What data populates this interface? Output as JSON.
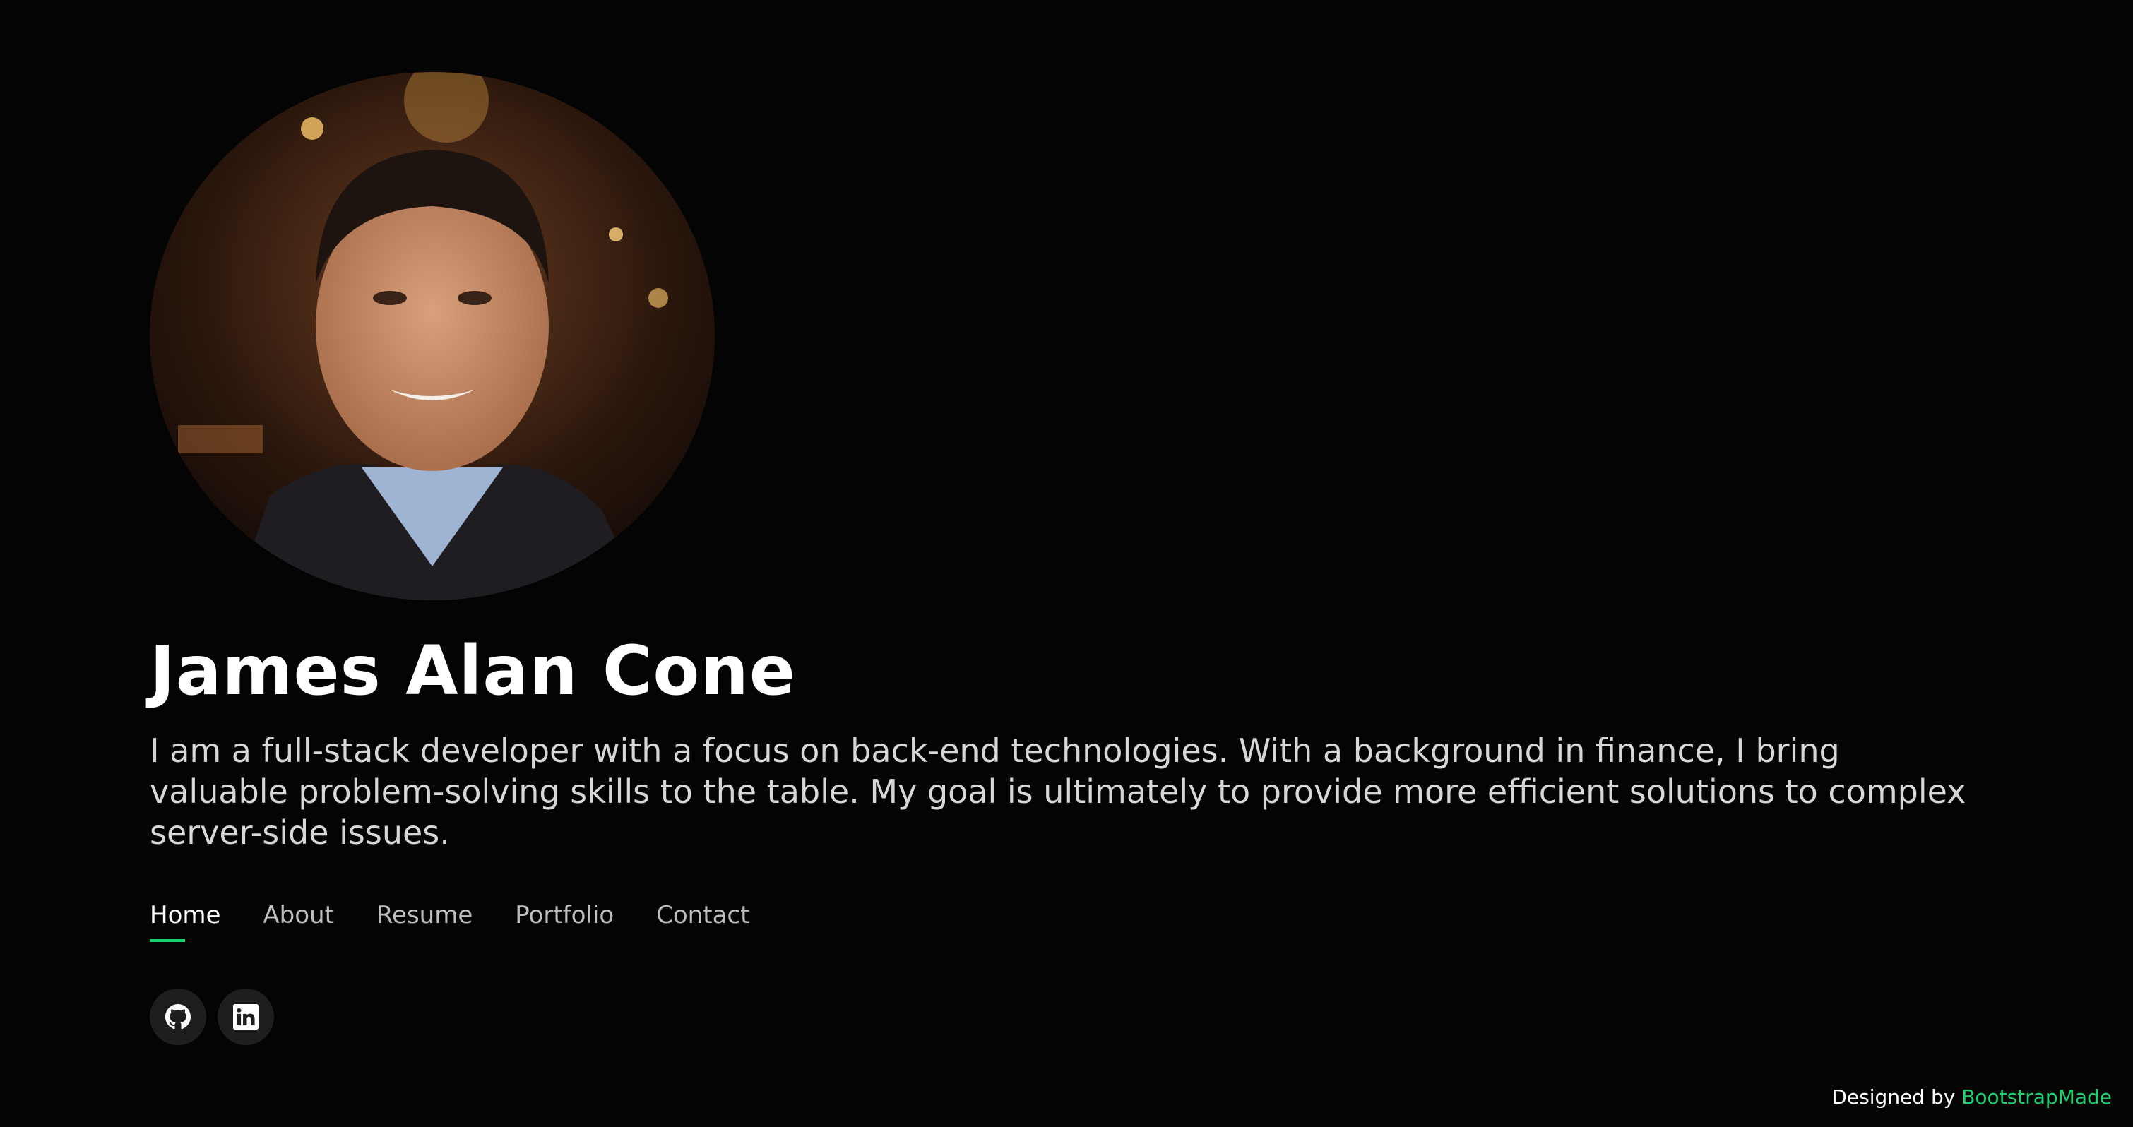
{
  "profile": {
    "name": "James Alan Cone",
    "bio": "I am a full-stack developer with a focus on back-end technologies. With a background in finance, I bring valuable problem-solving skills to the table. My goal is ultimately to provide more efficient solutions to complex server-side issues."
  },
  "nav": {
    "items": [
      {
        "label": "Home",
        "active": true
      },
      {
        "label": "About",
        "active": false
      },
      {
        "label": "Resume",
        "active": false
      },
      {
        "label": "Portfolio",
        "active": false
      },
      {
        "label": "Contact",
        "active": false
      }
    ]
  },
  "social": {
    "icons": [
      "github-icon",
      "linkedin-icon"
    ]
  },
  "credits": {
    "prefix": "Designed by",
    "link": "BootstrapMade"
  },
  "colors": {
    "background": "#040404",
    "accent": "#18d26e",
    "text": "#ffffff",
    "muted_text": "#d7d7d7"
  }
}
